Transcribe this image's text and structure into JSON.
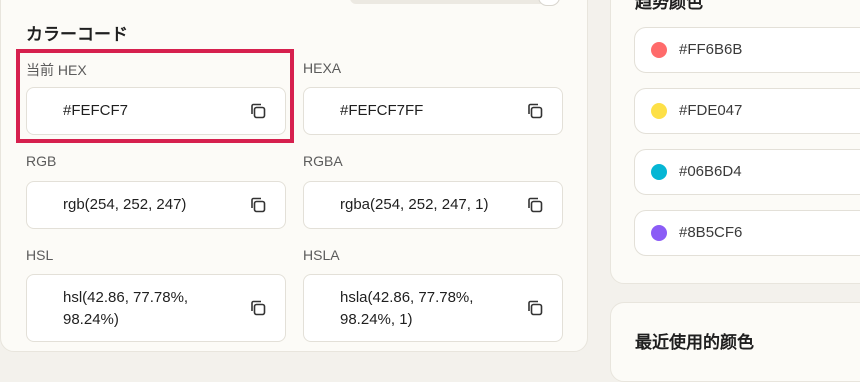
{
  "section_title": "カラーコード",
  "fields": {
    "hex": {
      "label": "当前 HEX",
      "value": "#FEFCF7"
    },
    "hexa": {
      "label": "HEXA",
      "value": "#FEFCF7FF"
    },
    "rgb": {
      "label": "RGB",
      "value": "rgb(254, 252, 247)"
    },
    "rgba": {
      "label": "RGBA",
      "value": "rgba(254, 252, 247, 1)"
    },
    "hsl": {
      "label": "HSL",
      "value_line1": "hsl(42.86, 77.78%,",
      "value_line2": "98.24%)"
    },
    "hsla": {
      "label": "HSLA",
      "value_line1": "hsla(42.86, 77.78%,",
      "value_line2": "98.24%, 1)"
    }
  },
  "trending": {
    "title": "趋势颜色",
    "swatches": [
      {
        "hex": "#FF6B6B",
        "color": "#FF6B6B"
      },
      {
        "hex": "#FDE047",
        "color": "#FDE047"
      },
      {
        "hex": "#06B6D4",
        "color": "#06B6D4"
      },
      {
        "hex": "#8B5CF6",
        "color": "#8B5CF6"
      }
    ]
  },
  "recent": {
    "title": "最近使用的颜色"
  },
  "colors": {
    "highlight": "#d6204e",
    "panel_bg": "#fcfbf7",
    "page_bg": "#f3f1ec"
  },
  "icons": {
    "copy": "copy-icon"
  }
}
